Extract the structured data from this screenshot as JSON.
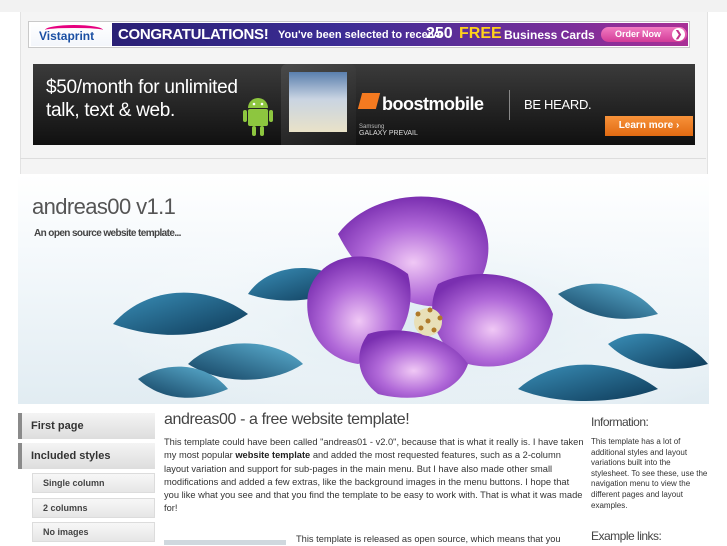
{
  "ads": {
    "vistaprint": {
      "logo": "Vistaprint",
      "headline": "CONGRATULATIONS!",
      "selected_text": "You've been selected to receive",
      "count": "250",
      "free": "FREE",
      "item": "Business Cards",
      "cta": "Order Now"
    },
    "boost": {
      "headline_line1": "$50/month for unlimited",
      "headline_line2": "talk, text & web.",
      "brand": "boostmobile",
      "tagline": "BE HEARD.",
      "phone_brand": "Samsung",
      "phone_model": "GALAXY PREVAIL",
      "cta": "Learn more ›"
    }
  },
  "header": {
    "title": "andreas00 v1.1",
    "slogan": "An open source website template..."
  },
  "menu": {
    "items": [
      {
        "label": "First page"
      },
      {
        "label": "Included styles"
      }
    ],
    "subitems": [
      {
        "label": "Single column"
      },
      {
        "label": "2 columns"
      },
      {
        "label": "No images"
      }
    ]
  },
  "main": {
    "title": "andreas00 - a free website template!",
    "para1_a": "This template could have been called \"andreas01 - v2.0\", because that is what it really is. I have taken my most popular ",
    "para1_bold": "website template",
    "para1_b": " and added the most requested features, such as a 2-column layout variation and support for sub-pages in the main menu. But I have also made other small modifications and added a few extras, like the background images in the menu buttons. I hope that you like what you see and that you find the template to be easy to work with. That is what it was made for!",
    "para2": "This template is released as open source, which means that you"
  },
  "sidebar": {
    "info_title": "Information:",
    "info_text": "This template has a lot of additional styles and layout variations built into the stylesheet. To see these, use the navigation menu to view the different pages and layout examples.",
    "links_title": "Example links:"
  },
  "colors": {
    "vistaprint_purple": "#3c2d95",
    "boost_orange": "#f47a20",
    "menu_border": "#8a8a8a"
  }
}
